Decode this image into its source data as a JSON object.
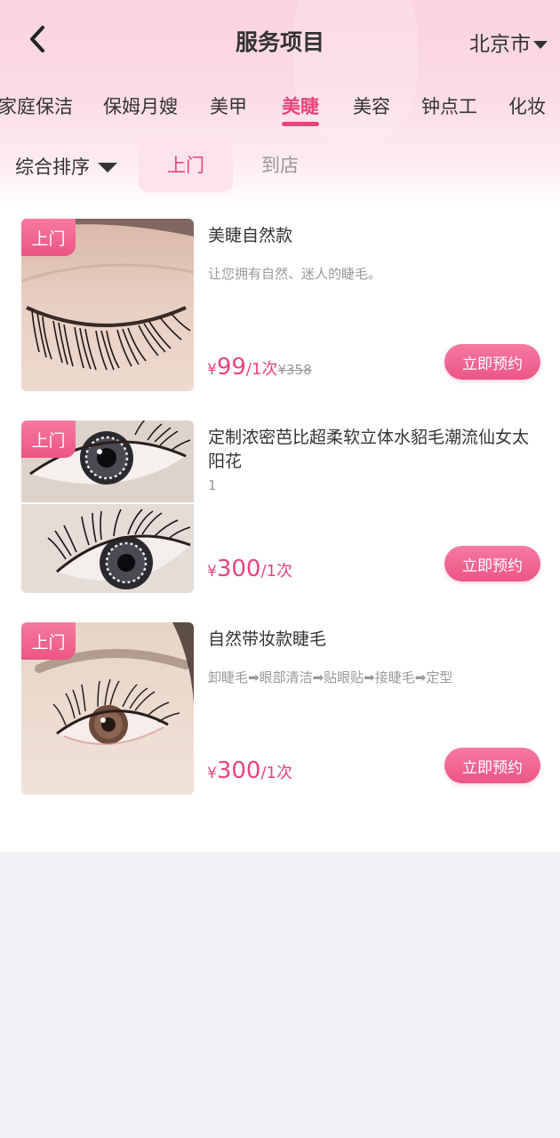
{
  "header": {
    "title": "服务项目",
    "city": "北京市"
  },
  "categories": [
    "家庭保洁",
    "保姆月嫂",
    "美甲",
    "美睫",
    "美容",
    "钟点工",
    "化妆"
  ],
  "active_category": "美睫",
  "filters": {
    "sort_label": "综合排序",
    "modes": [
      "上门",
      "到店"
    ],
    "active_mode": "上门"
  },
  "items": [
    {
      "tag": "上门",
      "title": "美睫自然款",
      "desc": "让您拥有自然、迷人的睫毛。",
      "currency": "¥",
      "price": "99",
      "unit": "/1次",
      "original_price": "¥358",
      "button": "立即预约"
    },
    {
      "tag": "上门",
      "title": "定制浓密芭比超柔软立体水貂毛潮流仙女太阳花",
      "desc": "1",
      "currency": "¥",
      "price": "300",
      "unit": "/1次",
      "original_price": "",
      "button": "立即预约"
    },
    {
      "tag": "上门",
      "title": "自然带妆款睫毛",
      "desc": "卸睫毛➡眼部清洁➡贴眼贴➡接睫毛➡定型",
      "currency": "¥",
      "price": "300",
      "unit": "/1次",
      "original_price": "",
      "button": "立即预约"
    }
  ],
  "colors": {
    "accent": "#e8457a",
    "button": "#ec5585",
    "header_bg": "#fad3de",
    "page_bg": "#f1f2f6"
  }
}
